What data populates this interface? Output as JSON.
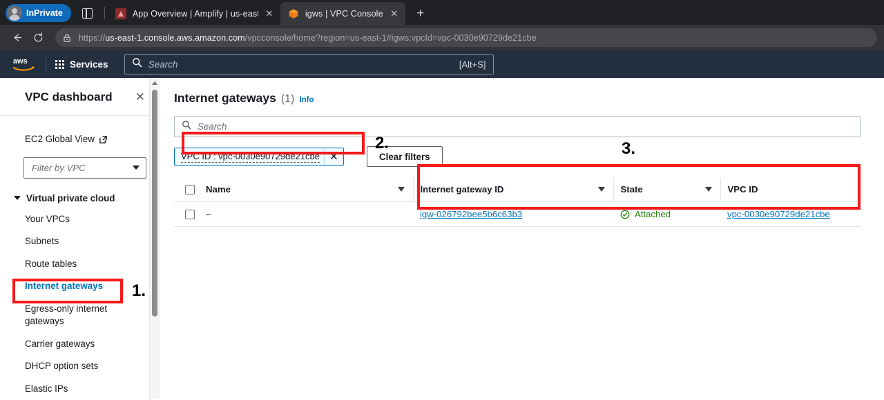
{
  "browser": {
    "profile_label": "InPrivate",
    "icons": {
      "splitscreen": "splitscreen-icon",
      "back": "back-arrow-icon",
      "reload": "reload-icon",
      "lock": "lock-icon",
      "newtab": "+"
    },
    "tabs": [
      {
        "title": "App Overview | Amplify | us-east-",
        "favicon": "amplify-favicon",
        "active": false,
        "close": "✕"
      },
      {
        "title": "igws | VPC Console",
        "favicon": "vpc-cube-favicon",
        "active": true,
        "close": "✕"
      }
    ],
    "omnibox": {
      "scheme": "https://",
      "host": "us-east-1.console.aws.amazon.com",
      "path": "/vpcconsole/home?region=us-east-1#igws:vpcId=vpc-0030e90729de21cbe"
    }
  },
  "aws_header": {
    "logo": "aws-logo",
    "services_label": "Services",
    "search_placeholder": "Search",
    "search_shortcut": "[Alt+S]"
  },
  "sidebar": {
    "title": "VPC dashboard",
    "close_icon": "✕",
    "ec2_global_view": "EC2 Global View",
    "filter_placeholder": "Filter by VPC",
    "group_label": "Virtual private cloud",
    "items": [
      {
        "label": "Your VPCs",
        "selected": false
      },
      {
        "label": "Subnets",
        "selected": false
      },
      {
        "label": "Route tables",
        "selected": false
      },
      {
        "label": "Internet gateways",
        "selected": true
      },
      {
        "label": "Egress-only internet gateways",
        "selected": false
      },
      {
        "label": "Carrier gateways",
        "selected": false
      },
      {
        "label": "DHCP option sets",
        "selected": false
      },
      {
        "label": "Elastic IPs",
        "selected": false
      }
    ]
  },
  "main": {
    "page_title": "Internet gateways",
    "count": "(1)",
    "info_label": "Info",
    "search_placeholder": "Search",
    "filter_token": "VPC ID : vpc-0030e90729de21cbe",
    "filter_token_remove": "✕",
    "clear_filters_label": "Clear filters",
    "table": {
      "columns": [
        "Name",
        "Internet gateway ID",
        "State",
        "VPC ID"
      ],
      "rows": [
        {
          "name": "–",
          "igw_id": "igw-026792bee5b6c63b3",
          "state": "Attached",
          "vpc_id": "vpc-0030e90729de21cbe"
        }
      ]
    }
  },
  "annotations": {
    "marker_1": "1.",
    "marker_2": "2.",
    "marker_3": "3.",
    "color": "#f41a1a"
  },
  "colors": {
    "aws_navy": "#232f3e",
    "link_blue": "#0073bb",
    "state_green": "#1d8102",
    "annotation_red": "#f41a1a"
  }
}
